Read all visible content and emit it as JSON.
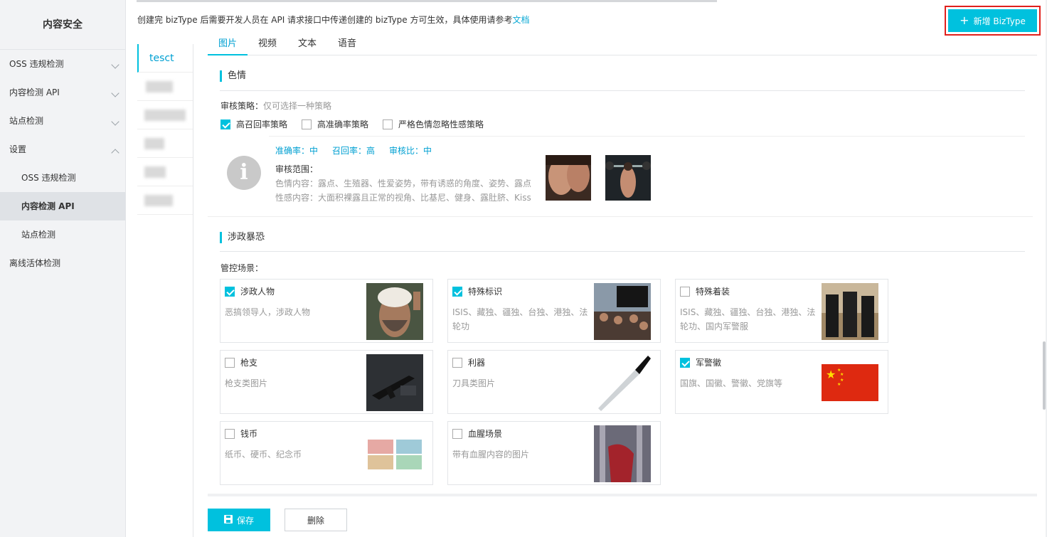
{
  "sidebar": {
    "brand": "内容安全",
    "items": [
      {
        "label": "OSS 违规检测"
      },
      {
        "label": "内容检测 API"
      },
      {
        "label": "站点检测"
      },
      {
        "label": "设置"
      },
      {
        "label": "OSS 违规检测"
      },
      {
        "label": "内容检测 API"
      },
      {
        "label": "站点检测"
      },
      {
        "label": "离线活体检测"
      }
    ]
  },
  "header": {
    "notice": "创建完 bizType 后需要开发人员在 API 请求接口中传递创建的 bizType 方可生效，具体使用请参考",
    "doc_link": "文档",
    "add_button": "新增 BizType"
  },
  "biz_list": {
    "active": "tesct"
  },
  "tabs": [
    "图片",
    "视频",
    "文本",
    "语音"
  ],
  "porn": {
    "title": "色情",
    "policy_label": "审核策略：",
    "policy_hint": "仅可选择一种策略",
    "options": [
      {
        "label": "高召回率策略",
        "checked": true
      },
      {
        "label": "高准确率策略",
        "checked": false
      },
      {
        "label": "严格色情忽略性感策略",
        "checked": false
      }
    ],
    "metrics": [
      "准确率：中",
      "召回率：高",
      "审核比：中"
    ],
    "scope_title": "审核范围：",
    "scope_lines": [
      "色情内容：露点、生殖器、性爱姿势，带有诱惑的角度、姿势、露点",
      "性感内容：大面积裸露且正常的视角、比基尼、健身、露肚脐、Kiss"
    ]
  },
  "terror": {
    "title": "涉政暴恐",
    "scene_label": "管控场景：",
    "cards": [
      {
        "title": "涉政人物",
        "desc": "恶搞领导人，涉政人物",
        "checked": true
      },
      {
        "title": "特殊标识",
        "desc": "ISIS、藏独、疆独、台独、港独、法轮功",
        "checked": true
      },
      {
        "title": "特殊着装",
        "desc": "ISIS、藏独、疆独、台独、港独、法轮功、国内军警服",
        "checked": false
      },
      {
        "title": "枪支",
        "desc": "枪支类图片",
        "checked": false
      },
      {
        "title": "利器",
        "desc": "刀具类图片",
        "checked": false
      },
      {
        "title": "军警徽",
        "desc": "国旗、国徽、警徽、党旗等",
        "checked": true
      },
      {
        "title": "钱币",
        "desc": "纸币、硬币、纪念币",
        "checked": false
      },
      {
        "title": "血腥场景",
        "desc": "带有血腥内容的图片",
        "checked": false
      }
    ]
  },
  "footer": {
    "save": "保存",
    "delete": "删除"
  },
  "colors": {
    "accent": "#00c1de",
    "highlight_border": "#e0201c",
    "sidebar_bg": "#f2f3f5"
  }
}
